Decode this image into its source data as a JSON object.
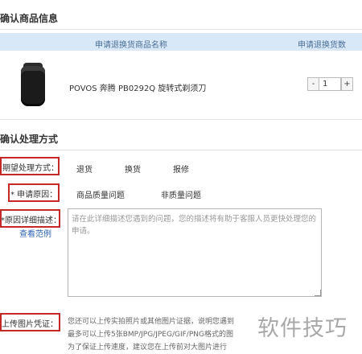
{
  "section1": {
    "title": "确认商品信息"
  },
  "table": {
    "col_name": "申请退换货商品名称",
    "col_qty": "申请退换货数"
  },
  "product": {
    "name": "POVOS 奔腾 PB0292Q 旋转式剃须刀",
    "qty": "1",
    "minus": "-",
    "plus": "+"
  },
  "section2": {
    "title": "确认处理方式"
  },
  "form": {
    "method_label": "期望处理方式：",
    "method_options": [
      "退货",
      "换货",
      "报修"
    ],
    "reason_label": "* 申请原因：",
    "reason_options": [
      "商品质量问题",
      "非质量问题"
    ],
    "detail_label": "*原因详细描述：",
    "example_link": "查看范例",
    "detail_placeholder": "请在此详细描述您遇到的问题，您的描述将有助于客服人员更快处理您的申请。",
    "upload_label": "上传图片凭证：",
    "upload_hints": [
      "您还可以上传实拍照片或其他图片证据，说明您遇到",
      "最多可以上传5张BMP/JPG/JPEG/GIF/PNG格式的图",
      "为了保证上传速度，建议您在上传前对大图片进行"
    ]
  },
  "watermark": "软件技巧",
  "colors": {
    "accent_red": "#c62828",
    "header_bg": "#d9e8f7",
    "link": "#2b62b4"
  }
}
